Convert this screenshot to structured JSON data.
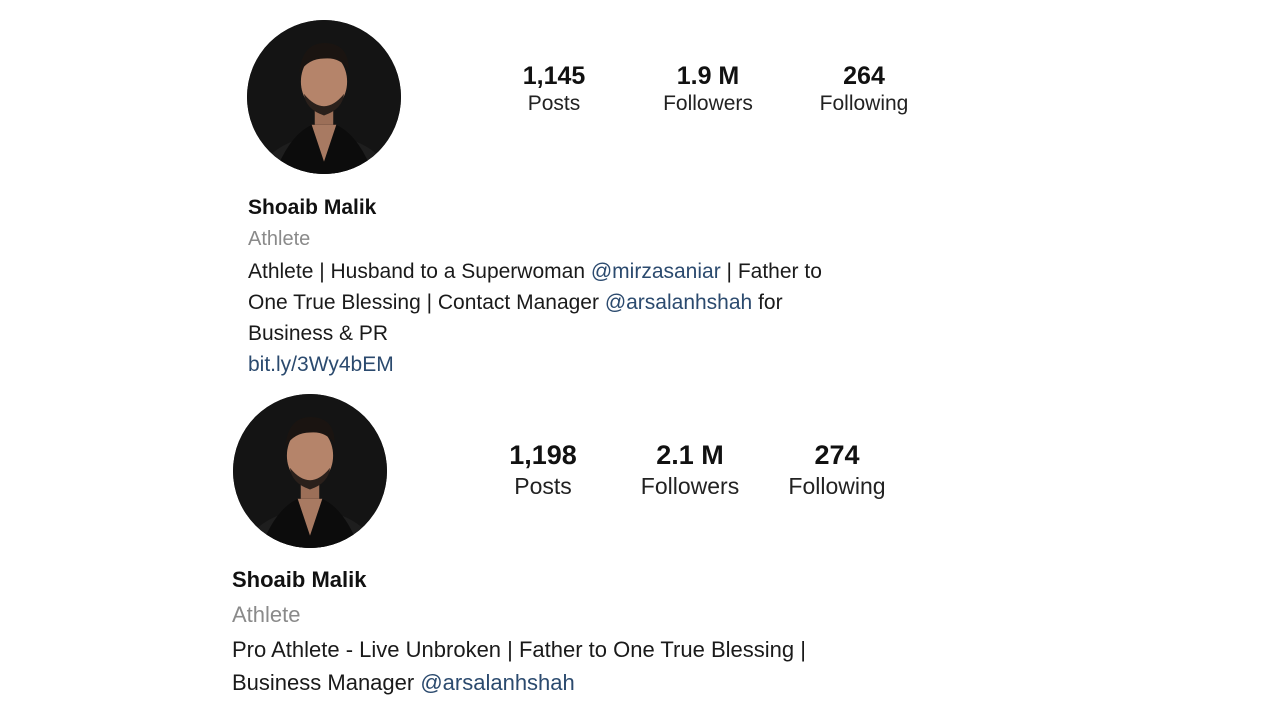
{
  "profiles": [
    {
      "name": "Shoaib Malik",
      "category": "Athlete",
      "stats": {
        "posts_value": "1,145",
        "posts_label": "Posts",
        "followers_value": "1.9 M",
        "followers_label": "Followers",
        "following_value": "264",
        "following_label": "Following"
      },
      "bio": {
        "line1_text": "Athlete | Husband to a Superwoman ",
        "line1_mention": "@mirzasaniar",
        "line1_after": " | Father to",
        "line2_text": "One True Blessing | Contact Manager ",
        "line2_mention": "@arsalanhshah",
        "line2_after": " for",
        "line3_text": "Business & PR"
      },
      "link": "bit.ly/3Wy4bEM"
    },
    {
      "name": "Shoaib Malik",
      "category": "Athlete",
      "stats": {
        "posts_value": "1,198",
        "posts_label": "Posts",
        "followers_value": "2.1 M",
        "followers_label": "Followers",
        "following_value": "274",
        "following_label": "Following"
      },
      "bio": {
        "line1_text": "Pro Athlete - Live Unbroken | Father to One True Blessing |",
        "line2_text": "Business Manager ",
        "line2_mention": "@arsalanhshah"
      }
    }
  ],
  "icons": {
    "avatar": "profile-photo"
  },
  "colors": {
    "mention": "#2b4a6e",
    "category": "#8a8a8a",
    "text": "#111111"
  }
}
